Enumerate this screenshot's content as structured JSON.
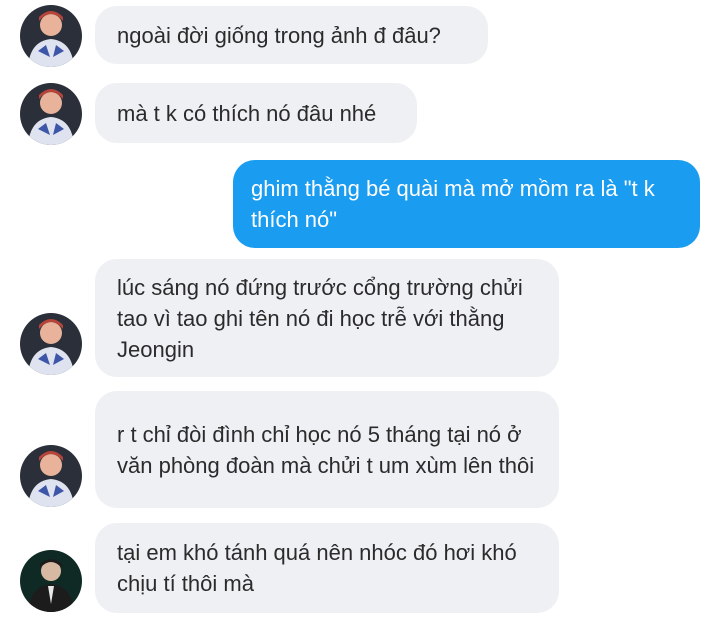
{
  "messages": [
    {
      "sender": "friend",
      "text": "ngoài đời giống trong ảnh đ đâu?"
    },
    {
      "sender": "friend",
      "text": "mà t k có thích nó đâu nhé"
    },
    {
      "sender": "me",
      "text": "ghim thằng bé quài mà mở mồm ra là \"t k thích nó\""
    },
    {
      "sender": "friend",
      "text": "lúc sáng nó đứng trước cổng trường chửi tao vì tao ghi tên nó đi học trễ với thằng Jeongin"
    },
    {
      "sender": "friend",
      "text": "r t chỉ đòi đình chỉ học nó 5 tháng tại nó ở văn phòng đoàn mà chửi t um xùm lên thôi"
    },
    {
      "sender": "other",
      "text": "tại em khó tánh quá nên nhóc đó hơi khó chịu tí thôi mà"
    }
  ],
  "colors": {
    "incoming_bubble": "#eef0f3",
    "outgoing_bubble": "#1a9cf0",
    "incoming_text": "#2b2b2b",
    "outgoing_text": "#ffffff"
  },
  "icons": {
    "friend_avatar": "avatar-photo",
    "other_avatar": "avatar-photo"
  }
}
